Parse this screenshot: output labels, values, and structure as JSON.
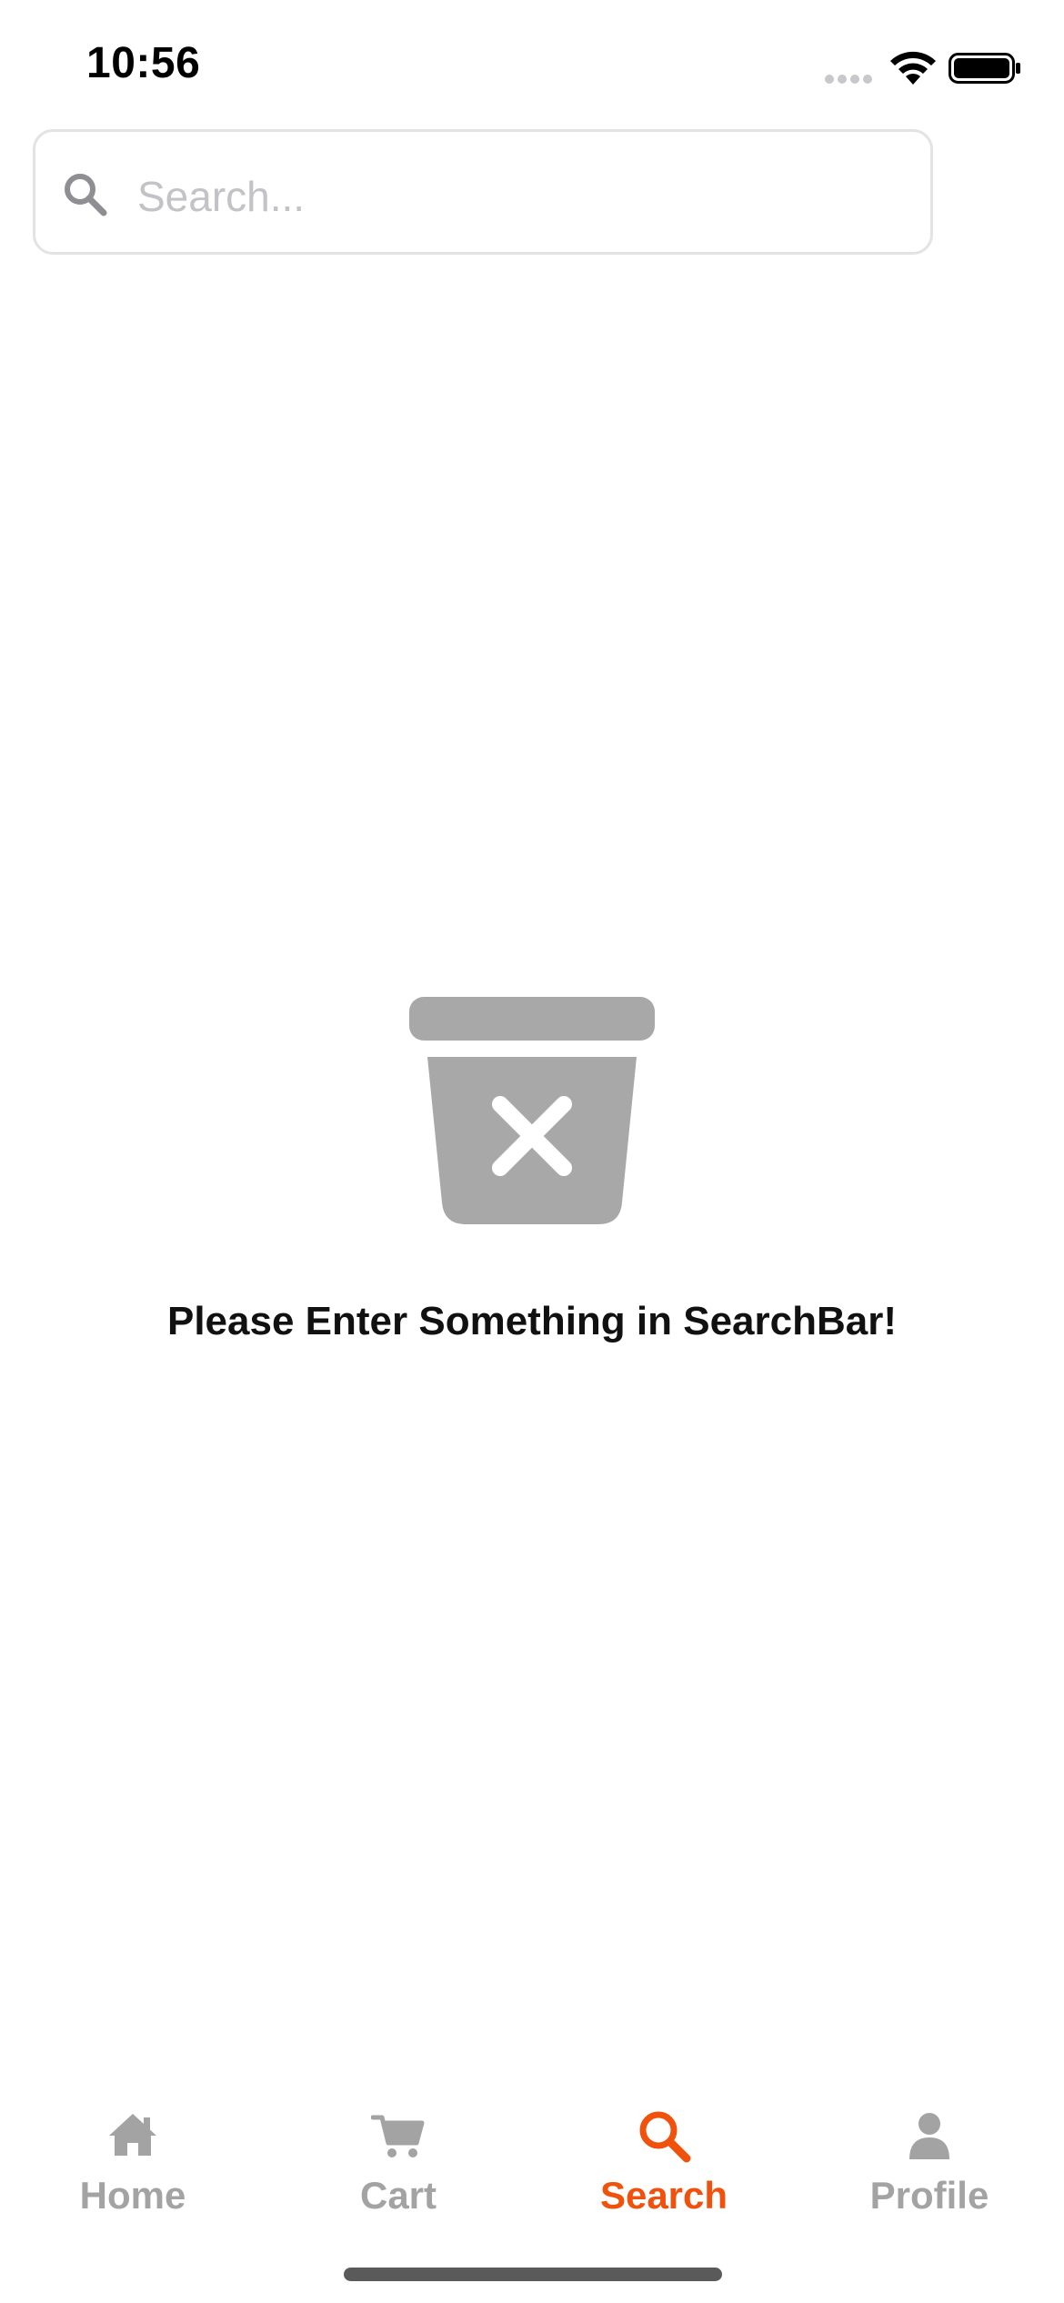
{
  "status_bar": {
    "time": "10:56"
  },
  "search": {
    "placeholder": "Search..."
  },
  "empty_state": {
    "message": "Please Enter Something in SearchBar!",
    "icon": "trash-x-icon"
  },
  "tabs": [
    {
      "label": "Home",
      "icon": "home-icon",
      "active": false
    },
    {
      "label": "Cart",
      "icon": "cart-icon",
      "active": false
    },
    {
      "label": "Search",
      "icon": "search-icon",
      "active": true
    },
    {
      "label": "Profile",
      "icon": "profile-icon",
      "active": false
    }
  ],
  "colors": {
    "accent": "#f0510d",
    "inactive": "#a3a3a3",
    "icon_gray": "#a8a8a8"
  }
}
